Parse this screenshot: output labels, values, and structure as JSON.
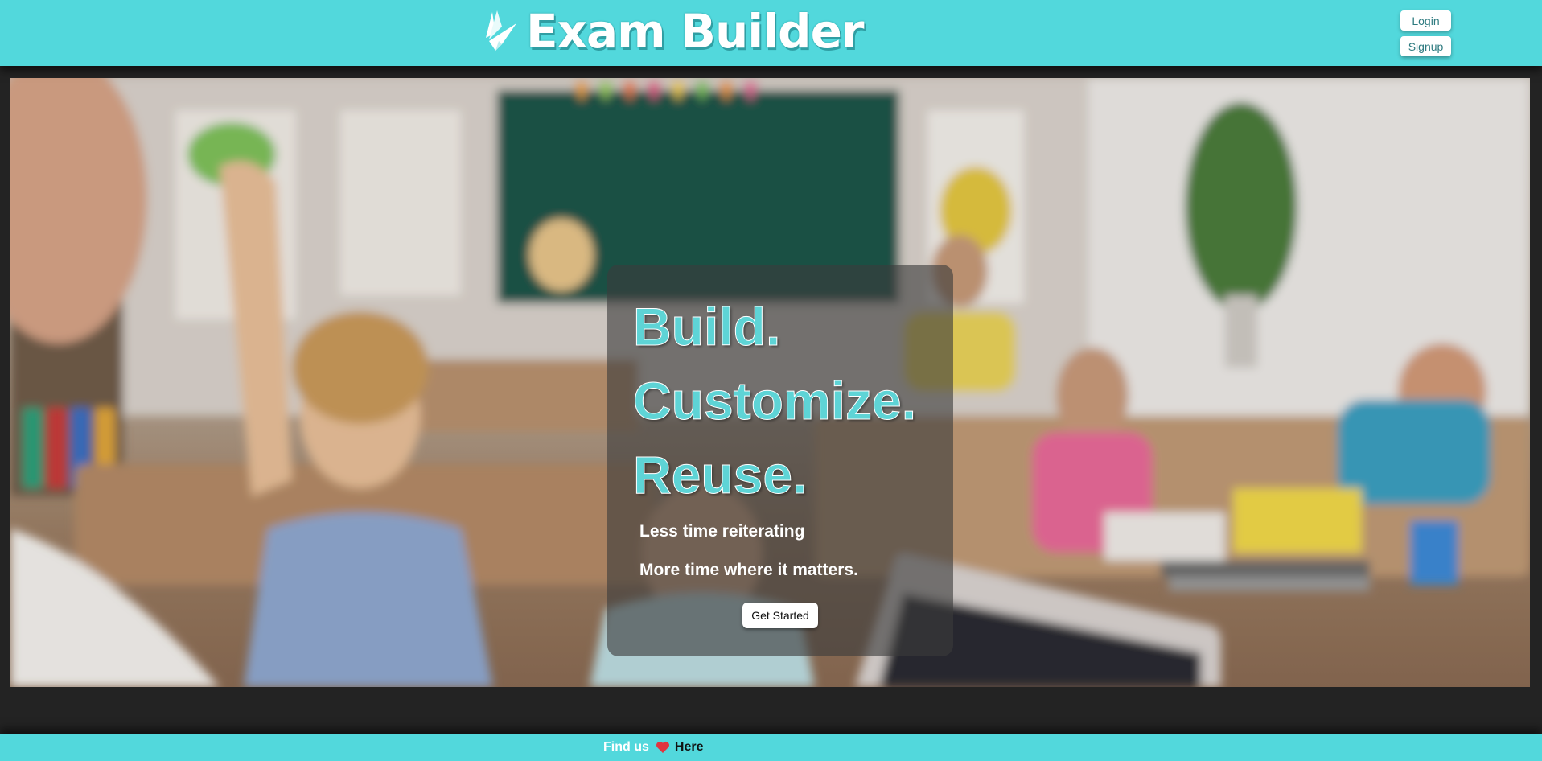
{
  "header": {
    "brand": "Exam Builder",
    "login_label": "Login",
    "signup_label": "Signup"
  },
  "hero": {
    "headline": [
      "Build.",
      "Customize.",
      "Reuse."
    ],
    "sublines": [
      "Less time reiterating",
      "More time where it matters."
    ],
    "cta_label": "Get Started",
    "background_image": "classroom-photo"
  },
  "footer": {
    "find_us": "Find us",
    "link_label": "Here",
    "icon": "heart-icon"
  },
  "colors": {
    "accent": "#52d8dc",
    "dark_band": "#232323",
    "headline": "#5ed4d6",
    "heart": "#e0353f"
  }
}
